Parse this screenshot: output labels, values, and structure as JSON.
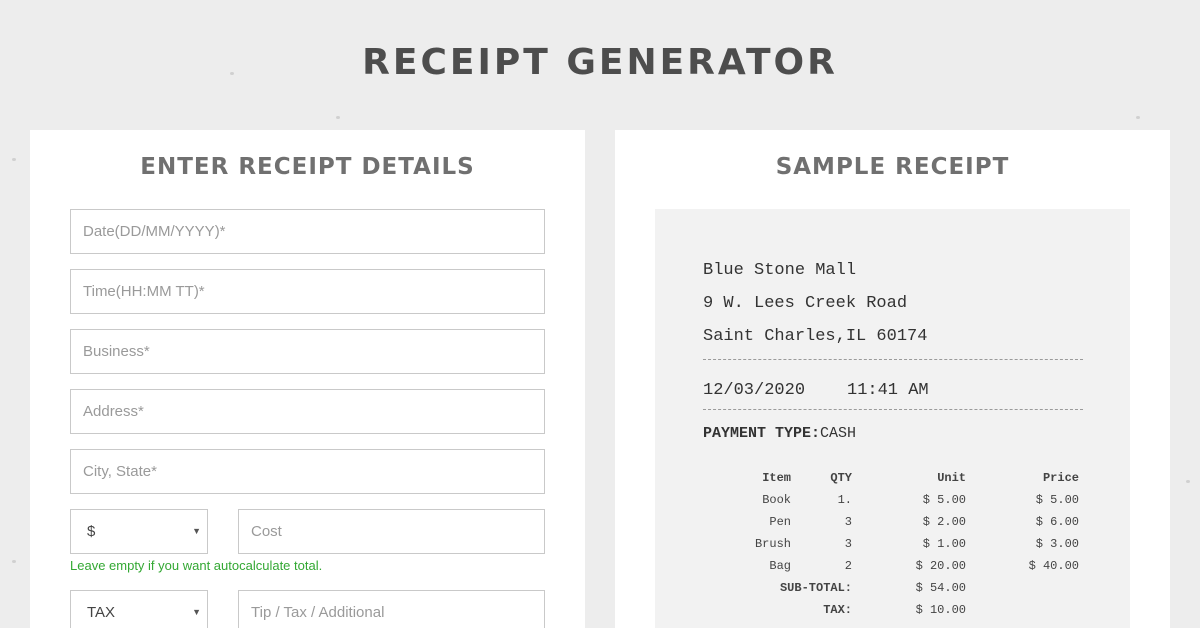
{
  "page": {
    "title": "RECEIPT GENERATOR"
  },
  "form": {
    "title": "ENTER RECEIPT DETAILS",
    "date_placeholder": "Date(DD/MM/YYYY)*",
    "time_placeholder": "Time(HH:MM TT)*",
    "business_placeholder": "Business*",
    "address_placeholder": "Address*",
    "city_placeholder": "City, State*",
    "currency_value": "$",
    "cost_placeholder": "Cost",
    "hint": "Leave empty if you want autocalculate total.",
    "tax_select_value": "TAX",
    "tip_placeholder": "Tip / Tax / Additional",
    "colors": {
      "hint": "#33a833"
    }
  },
  "sample": {
    "title": "SAMPLE RECEIPT",
    "business": "Blue Stone Mall",
    "address": "9 W. Lees Creek Road",
    "city": "Saint Charles,IL 60174",
    "date": "12/03/2020",
    "time": "11:41 AM",
    "payment_label": "PAYMENT TYPE:",
    "payment_value": "CASH",
    "headers": {
      "item": "Item",
      "qty": "QTY",
      "unit": "Unit",
      "price": "Price"
    },
    "rows": [
      {
        "item": "Book",
        "qty": "1.",
        "unit": "$ 5.00",
        "price": "$ 5.00"
      },
      {
        "item": "Pen",
        "qty": "3",
        "unit": "$ 2.00",
        "price": "$ 6.00"
      },
      {
        "item": "Brush",
        "qty": "3",
        "unit": "$ 1.00",
        "price": "$ 3.00"
      },
      {
        "item": "Bag",
        "qty": "2",
        "unit": "$ 20.00",
        "price": "$ 40.00"
      }
    ],
    "subtotal_label": "SUB-TOTAL:",
    "subtotal_value": "$ 54.00",
    "tax_label": "TAX:",
    "tax_value": "$ 10.00"
  }
}
